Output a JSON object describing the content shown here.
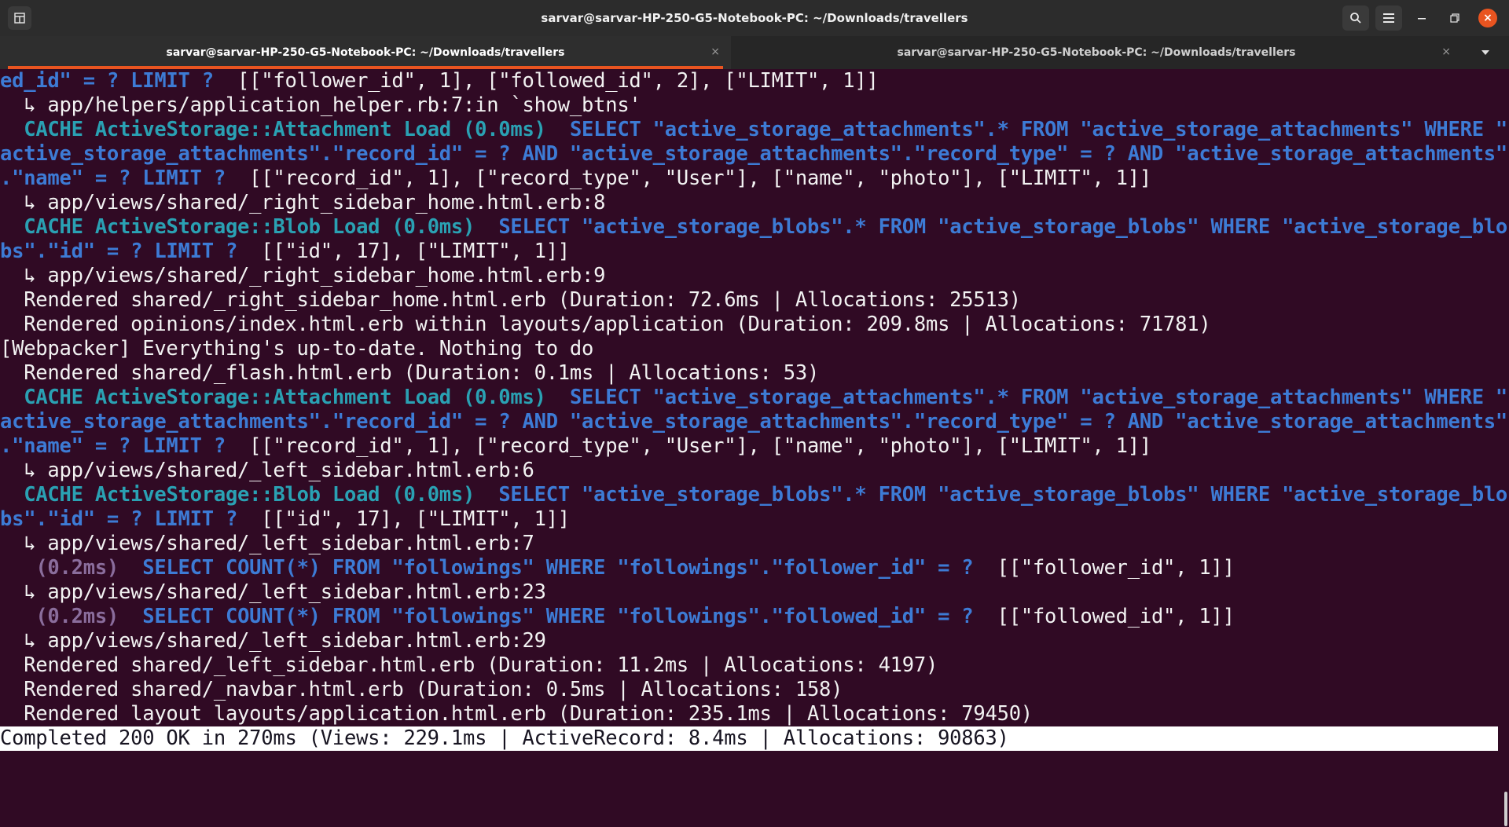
{
  "window": {
    "title": "sarvar@sarvar-HP-250-G5-Notebook-PC: ~/Downloads/travellers",
    "icons": [
      "pin-icon",
      "search-icon",
      "hamburger-menu-icon",
      "minimize-icon",
      "maximize-icon",
      "close-icon"
    ]
  },
  "tabs": [
    {
      "label": "sarvar@sarvar-HP-250-G5-Notebook-PC: ~/Downloads/travellers",
      "close": "×"
    },
    {
      "label": "sarvar@sarvar-HP-250-G5-Notebook-PC: ~/Downloads/travellers",
      "close": "×"
    }
  ],
  "terminal": {
    "colors": {
      "background": "#300a24",
      "cache": "#2aa1b3",
      "sql": "#3d7bd5",
      "duration": "#8a6d9c",
      "accent": "#e95420"
    },
    "lines": [
      [
        [
          "bl",
          "ed_id\" = ? LIMIT ?"
        ],
        [
          "n",
          "  [[\"follower_id\", 1], [\"followed_id\", 2], [\"LIMIT\", 1]]"
        ]
      ],
      [
        [
          "n",
          "  ↳ app/helpers/application_helper.rb:7:in `show_btns'"
        ]
      ],
      [
        [
          "n",
          "  "
        ],
        [
          "cy",
          "CACHE ActiveStorage::Attachment Load (0.0ms)"
        ],
        [
          "n",
          "  "
        ],
        [
          "bl",
          "SELECT \"active_storage_attachments\".* FROM \"active_storage_attachments\" WHERE \""
        ]
      ],
      [
        [
          "bl",
          "active_storage_attachments\".\"record_id\" = ? AND \"active_storage_attachments\".\"record_type\" = ? AND \"active_storage_attachments\""
        ]
      ],
      [
        [
          "bl",
          ".\"name\" = ? LIMIT ?"
        ],
        [
          "n",
          "  [[\"record_id\", 1], [\"record_type\", \"User\"], [\"name\", \"photo\"], [\"LIMIT\", 1]]"
        ]
      ],
      [
        [
          "n",
          "  ↳ app/views/shared/_right_sidebar_home.html.erb:8"
        ]
      ],
      [
        [
          "n",
          "  "
        ],
        [
          "cy",
          "CACHE ActiveStorage::Blob Load (0.0ms)"
        ],
        [
          "n",
          "  "
        ],
        [
          "bl",
          "SELECT \"active_storage_blobs\".* FROM \"active_storage_blobs\" WHERE \"active_storage_blo"
        ]
      ],
      [
        [
          "bl",
          "bs\".\"id\" = ? LIMIT ?"
        ],
        [
          "n",
          "  [[\"id\", 17], [\"LIMIT\", 1]]"
        ]
      ],
      [
        [
          "n",
          "  ↳ app/views/shared/_right_sidebar_home.html.erb:9"
        ]
      ],
      [
        [
          "n",
          "  Rendered shared/_right_sidebar_home.html.erb (Duration: 72.6ms | Allocations: 25513)"
        ]
      ],
      [
        [
          "n",
          "  Rendered opinions/index.html.erb within layouts/application (Duration: 209.8ms | Allocations: 71781)"
        ]
      ],
      [
        [
          "n",
          "[Webpacker] Everything's up-to-date. Nothing to do"
        ]
      ],
      [
        [
          "n",
          "  Rendered shared/_flash.html.erb (Duration: 0.1ms | Allocations: 53)"
        ]
      ],
      [
        [
          "n",
          "  "
        ],
        [
          "cy",
          "CACHE ActiveStorage::Attachment Load (0.0ms)"
        ],
        [
          "n",
          "  "
        ],
        [
          "bl",
          "SELECT \"active_storage_attachments\".* FROM \"active_storage_attachments\" WHERE \""
        ]
      ],
      [
        [
          "bl",
          "active_storage_attachments\".\"record_id\" = ? AND \"active_storage_attachments\".\"record_type\" = ? AND \"active_storage_attachments\""
        ]
      ],
      [
        [
          "bl",
          ".\"name\" = ? LIMIT ?"
        ],
        [
          "n",
          "  [[\"record_id\", 1], [\"record_type\", \"User\"], [\"name\", \"photo\"], [\"LIMIT\", 1]]"
        ]
      ],
      [
        [
          "n",
          "  ↳ app/views/shared/_left_sidebar.html.erb:6"
        ]
      ],
      [
        [
          "n",
          "  "
        ],
        [
          "cy",
          "CACHE ActiveStorage::Blob Load (0.0ms)"
        ],
        [
          "n",
          "  "
        ],
        [
          "bl",
          "SELECT \"active_storage_blobs\".* FROM \"active_storage_blobs\" WHERE \"active_storage_blo"
        ]
      ],
      [
        [
          "bl",
          "bs\".\"id\" = ? LIMIT ?"
        ],
        [
          "n",
          "  [[\"id\", 17], [\"LIMIT\", 1]]"
        ]
      ],
      [
        [
          "n",
          "  ↳ app/views/shared/_left_sidebar.html.erb:7"
        ]
      ],
      [
        [
          "n",
          "   "
        ],
        [
          "pu",
          "(0.2ms)"
        ],
        [
          "n",
          "  "
        ],
        [
          "bl",
          "SELECT COUNT(*) FROM \"followings\" WHERE \"followings\".\"follower_id\" = ?"
        ],
        [
          "n",
          "  [[\"follower_id\", 1]]"
        ]
      ],
      [
        [
          "n",
          "  ↳ app/views/shared/_left_sidebar.html.erb:23"
        ]
      ],
      [
        [
          "n",
          "   "
        ],
        [
          "pu",
          "(0.2ms)"
        ],
        [
          "n",
          "  "
        ],
        [
          "bl",
          "SELECT COUNT(*) FROM \"followings\" WHERE \"followings\".\"followed_id\" = ?"
        ],
        [
          "n",
          "  [[\"followed_id\", 1]]"
        ]
      ],
      [
        [
          "n",
          "  ↳ app/views/shared/_left_sidebar.html.erb:29"
        ]
      ],
      [
        [
          "n",
          "  Rendered shared/_left_sidebar.html.erb (Duration: 11.2ms | Allocations: 4197)"
        ]
      ],
      [
        [
          "n",
          "  Rendered shared/_navbar.html.erb (Duration: 0.5ms | Allocations: 158)"
        ]
      ],
      [
        [
          "n",
          "  Rendered layout layouts/application.html.erb (Duration: 235.1ms | Allocations: 79450)"
        ]
      ],
      [
        [
          "hl",
          "Completed 200 OK in 270ms (Views: 229.1ms | ActiveRecord: 8.4ms | Allocations: 90863)"
        ]
      ]
    ]
  }
}
